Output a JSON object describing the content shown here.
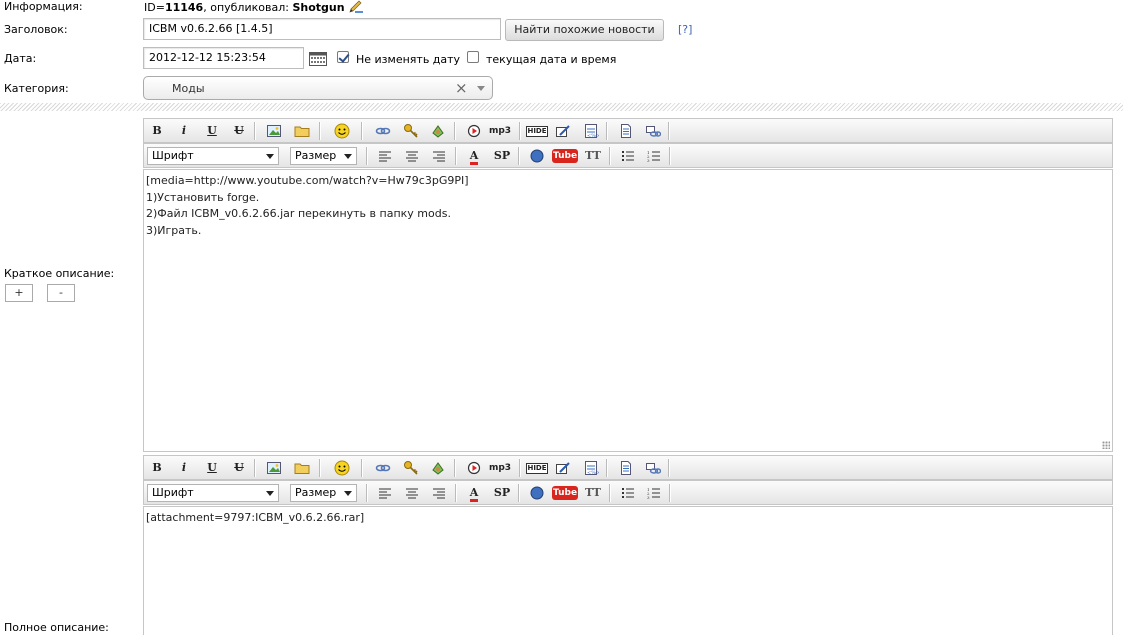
{
  "info": {
    "label": "Информация:",
    "id_prefix": "ID=",
    "id_value": "11146",
    "published_by": ", опубликовал: ",
    "author": "Shotgun"
  },
  "title_row": {
    "label": "Заголовок:",
    "value": "ICBM v0.6.2.66 [1.4.5]",
    "find_button": "Найти похожие новости",
    "help": "[?]"
  },
  "date_row": {
    "label": "Дата:",
    "value": "2012-12-12 15:23:54",
    "keep_date_label": "Не изменять дату",
    "keep_date_checked": true,
    "current_label": "текущая дата и время",
    "current_checked": false
  },
  "category_row": {
    "label": "Категория:",
    "value": "Моды",
    "clear": "×"
  },
  "toolbar": {
    "bold": "B",
    "italic": "i",
    "underline": "U",
    "strike": "U",
    "mp3": "mp3",
    "hide": "HIDE",
    "sp": "SP",
    "tube": "Tube",
    "tt": "TT",
    "font_label": "Шрифт",
    "size_label": "Размер",
    "color_letter": "A",
    "icons": [
      "bold-icon",
      "italic-icon",
      "underline-icon",
      "strike-icon",
      "image-icon",
      "folder-icon",
      "smiley-icon",
      "link-icon",
      "key-icon",
      "leech-icon",
      "flash-icon",
      "mp3-icon",
      "hide-icon",
      "spoiler-edit-icon",
      "quote-icon",
      "page-icon",
      "link-break-icon",
      "align-left-icon",
      "align-center-icon",
      "align-right-icon",
      "font-color-icon",
      "spoiler-icon",
      "compass-icon",
      "youtube-icon",
      "typograf-icon",
      "bullet-list-icon",
      "numbered-list-icon"
    ]
  },
  "short_desc": {
    "label": "Краткое описание:",
    "plus": "+",
    "minus": "-",
    "lines": [
      "[media=http://www.youtube.com/watch?v=Hw79c3pG9PI]",
      "1)Установить forge.",
      "2)Файл ICBM_v0.6.2.66.jar перекинуть в папку mods.",
      "3)Играть."
    ]
  },
  "full_desc": {
    "label": "Полное описание:",
    "lines": [
      "[attachment=9797:ICBM_v0.6.2.66.rar]"
    ]
  },
  "colors": {
    "link": "#3a66b1",
    "border": "#c6c6c6",
    "youtube_red": "#d8251d"
  }
}
